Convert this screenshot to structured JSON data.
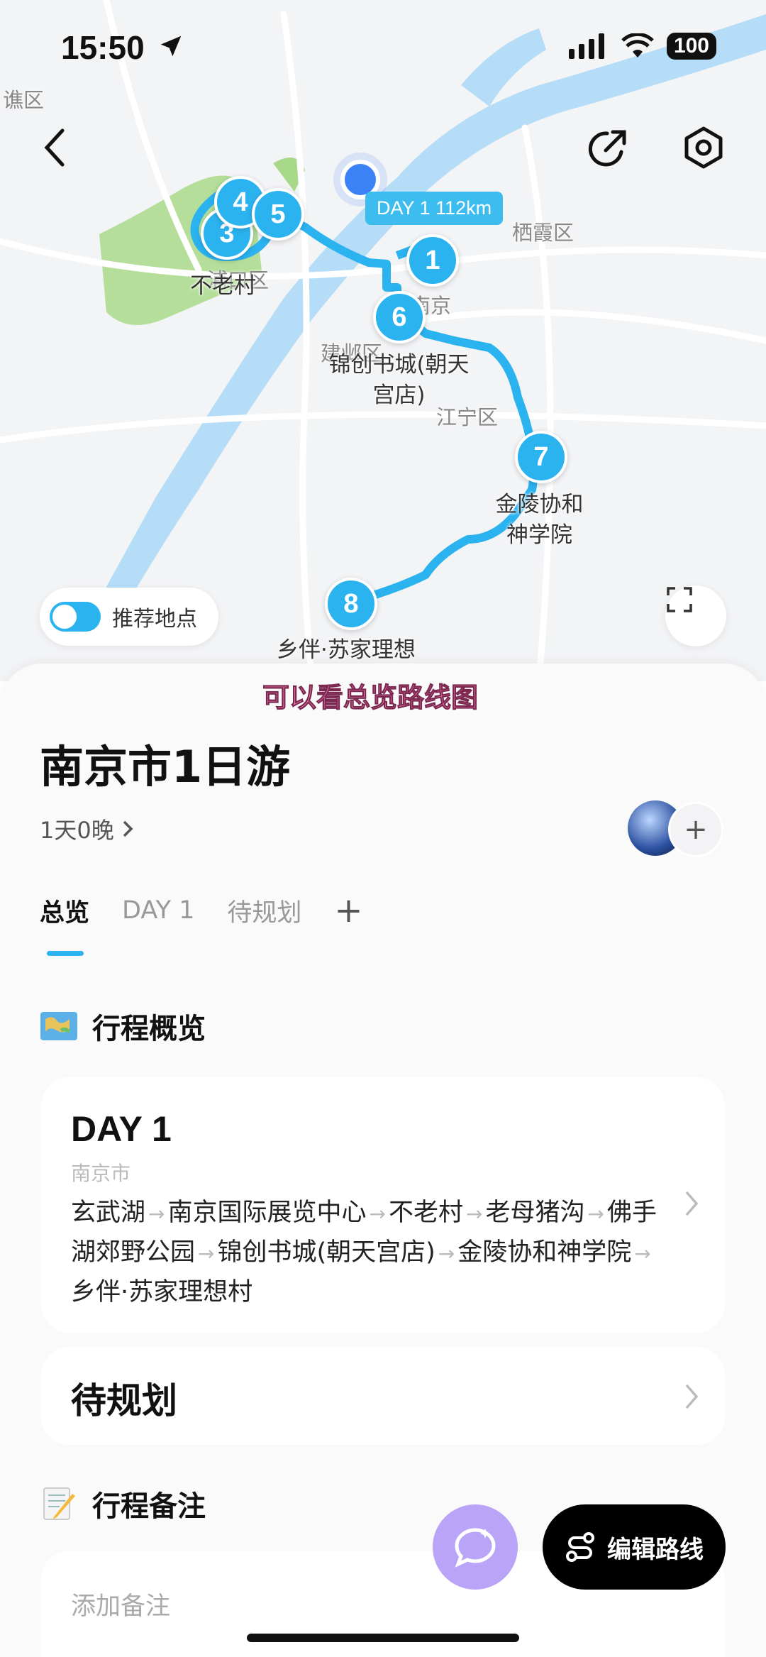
{
  "status_bar": {
    "time": "15:50",
    "battery": "100"
  },
  "map": {
    "day_badge": "DAY 1 112km",
    "districts": [
      "谯区",
      "栖霞区",
      "江宁区",
      "建邺区",
      "南京",
      "浦口区"
    ],
    "place_labels": [
      "不老村",
      "锦创书城(朝天宫店)",
      "金陵协和神学院",
      "乡伴·苏家理想"
    ],
    "markers": [
      "1",
      "3",
      "4",
      "5",
      "6",
      "7",
      "8"
    ],
    "recommend_toggle": {
      "label": "推荐地点",
      "on": true
    }
  },
  "caption": "可以看总览路线图",
  "trip": {
    "title": "南京市1日游",
    "duration": "1天0晚",
    "tabs": [
      "总览",
      "DAY 1",
      "待规划"
    ],
    "add_tab": "+"
  },
  "overview": {
    "heading": "行程概览",
    "day": {
      "title": "DAY 1",
      "city": "南京市",
      "stops": [
        "玄武湖",
        "南京国际展览中心",
        "不老村",
        "老母猪沟",
        "佛手湖郊野公园",
        "锦创书城(朝天宫店)",
        "金陵协和神学院",
        "乡伴·苏家理想村"
      ]
    },
    "pending": "待规划"
  },
  "notes": {
    "heading": "行程备注",
    "placeholder": "添加备注"
  },
  "actions": {
    "edit_route": "编辑路线"
  },
  "colors": {
    "accent": "#2bb3f0",
    "ai_button": "#b9a4f7",
    "route": "#2bb3f0"
  },
  "icons": [
    "back-icon",
    "share-icon",
    "settings-icon",
    "fullscreen-icon",
    "ai-chat-icon",
    "route-edit-icon",
    "chevron-right-icon"
  ]
}
